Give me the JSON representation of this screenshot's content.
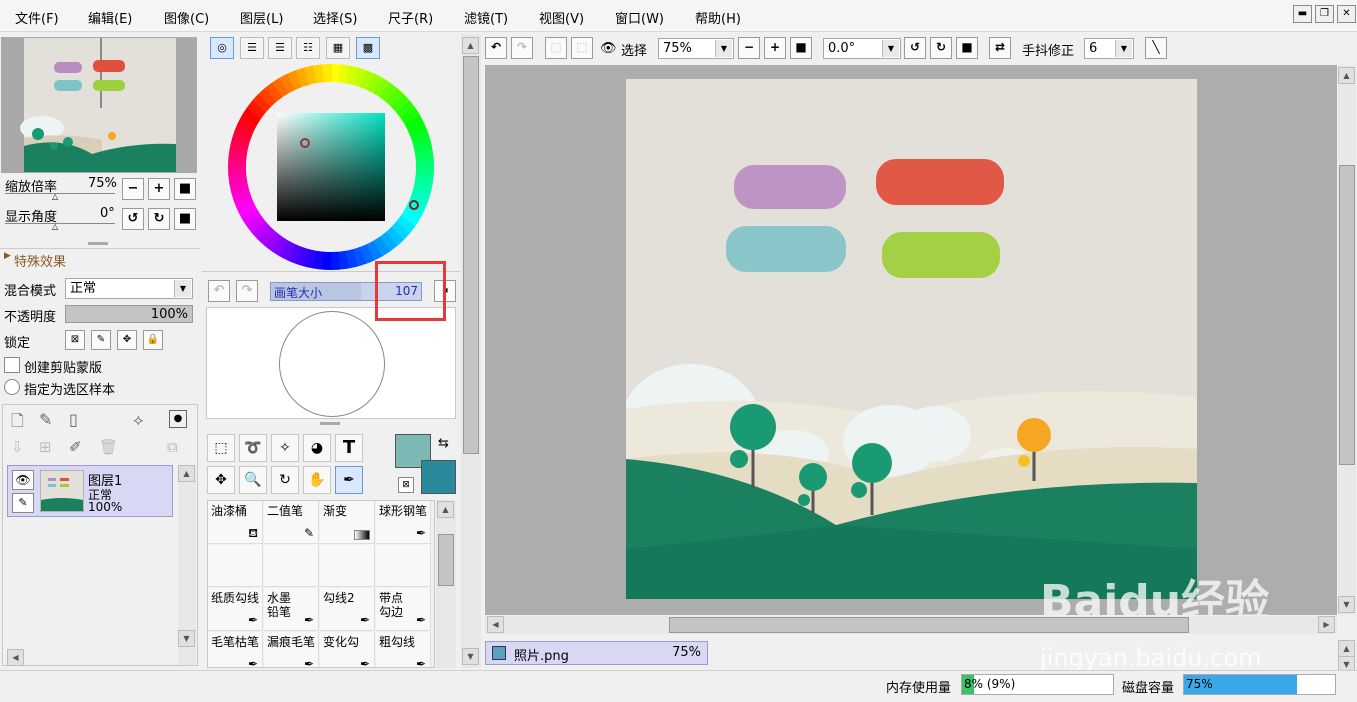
{
  "menu": [
    "文件(F)",
    "编辑(E)",
    "图像(C)",
    "图层(L)",
    "选择(S)",
    "尺子(R)",
    "滤镜(T)",
    "视图(V)",
    "窗口(W)",
    "帮助(H)"
  ],
  "navigator": {
    "zoom_label": "缩放倍率",
    "zoom_value": "75%",
    "angle_label": "显示角度",
    "angle_value": "0°"
  },
  "effects": {
    "title": "特殊效果"
  },
  "layer_props": {
    "blend_label": "混合模式",
    "blend_value": "正常",
    "opacity_label": "不透明度",
    "opacity_value": "100%",
    "lock_label": "锁定",
    "clip_label": "创建剪贴蒙版",
    "selection_label": "指定为选区样本"
  },
  "layers": [
    {
      "name": "图层1",
      "mode": "正常",
      "opacity": "100%"
    }
  ],
  "brush_size": {
    "label": "画笔大小",
    "value": "107"
  },
  "brushes": [
    "油漆桶",
    "二值笔",
    "渐变",
    "球形钢笔",
    "纸质勾线",
    "水墨\n铅笔",
    "勾线2",
    "带点\n勾边",
    "毛笔枯笔",
    "漏痕毛笔",
    "变化勾",
    "粗勾线"
  ],
  "toolbar": {
    "select_label": "选择",
    "zoom_value": "75%",
    "angle_value": "0.0°",
    "stabilizer_label": "手抖修正",
    "stabilizer_value": "6"
  },
  "document_tab": {
    "name": "照片.png",
    "zoom": "75%"
  },
  "status": {
    "memory_label": "内存使用量",
    "memory_value": "8% (9%)",
    "memory_fill": 0.08,
    "disk_label": "磁盘容量",
    "disk_value": "75%",
    "disk_fill": 0.75
  },
  "watermark": {
    "brand": "Baidu经验",
    "url": "jingyan.baidu.com"
  },
  "colors": {
    "primary": "#7db8b5",
    "secondary": "#2a8a9c",
    "highlight": "#e53a3a",
    "ground": "#1a8060"
  }
}
